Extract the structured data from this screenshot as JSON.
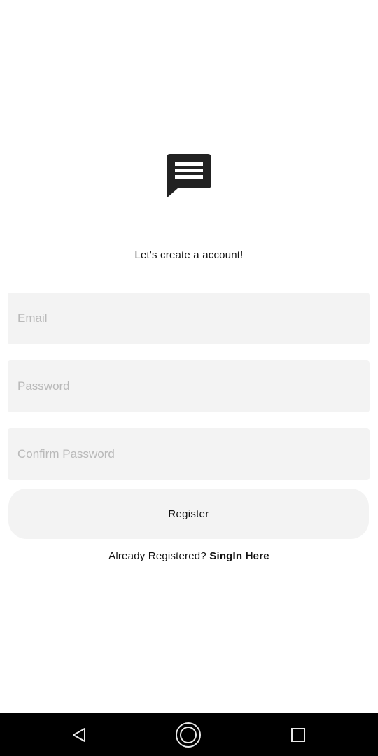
{
  "app": {
    "logo_icon": "chat-message-icon",
    "tagline": "Let's create a account!"
  },
  "form": {
    "email_placeholder": "Email",
    "password_placeholder": "Password",
    "confirm_password_placeholder": "Confirm Password",
    "register_label": "Register"
  },
  "signin": {
    "prompt": "Already Registered? ",
    "link_label": "SingIn Here"
  },
  "navbar": {
    "back_icon": "back-triangle-icon",
    "home_icon": "home-circle-icon",
    "recent_icon": "recent-apps-square-icon"
  },
  "colors": {
    "field_background": "#f3f3f3",
    "placeholder": "#b9b9b9",
    "navbar_background": "#000000"
  }
}
